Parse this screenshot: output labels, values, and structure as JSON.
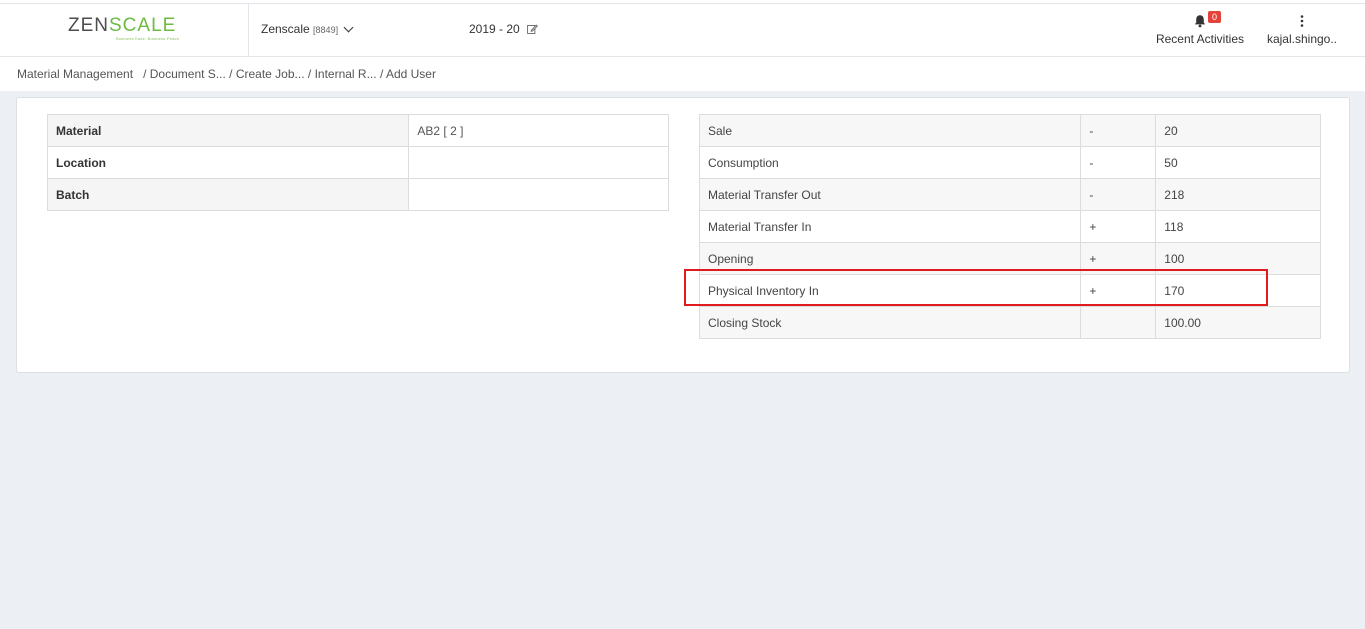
{
  "header": {
    "logo": {
      "part1": "ZEN",
      "part2": "SCALE",
      "tagline": "Business Ease. Business Peace."
    },
    "company": {
      "name": "Zenscale",
      "code": "[8849]"
    },
    "year": "2019 - 20",
    "notifications": {
      "count": "0",
      "label": "Recent Activities"
    },
    "user": {
      "name": "kajal.shingo.."
    }
  },
  "breadcrumb": {
    "items": [
      "Material Management",
      "Document S...",
      "Create Job...",
      "Internal R...",
      "Add User"
    ],
    "separator": "/"
  },
  "left_table": {
    "rows": [
      {
        "label": "Material",
        "value": "AB2 [ 2 ]"
      },
      {
        "label": "Location",
        "value": ""
      },
      {
        "label": "Batch",
        "value": ""
      }
    ]
  },
  "right_table": {
    "rows": [
      {
        "label": "Sale",
        "sign": "-",
        "value": "20"
      },
      {
        "label": "Consumption",
        "sign": "-",
        "value": "50"
      },
      {
        "label": "Material Transfer Out",
        "sign": "-",
        "value": "218"
      },
      {
        "label": "Material Transfer In",
        "sign": "+",
        "value": "118"
      },
      {
        "label": "Opening",
        "sign": "+",
        "value": "100"
      },
      {
        "label": "Physical Inventory In",
        "sign": "+",
        "value": "170"
      },
      {
        "label": "Closing Stock",
        "sign": "",
        "value": "100.00"
      }
    ]
  },
  "icons": {
    "company_dropdown": "chevron-down-icon",
    "year_edit": "edit-icon",
    "notifications": "bell-icon",
    "user_menu": "kebab-icon"
  },
  "colors": {
    "accent_green": "#6dbb45",
    "badge_red": "#e4423b",
    "highlight_red": "#e01b1b",
    "background": "#ecf0f4"
  }
}
